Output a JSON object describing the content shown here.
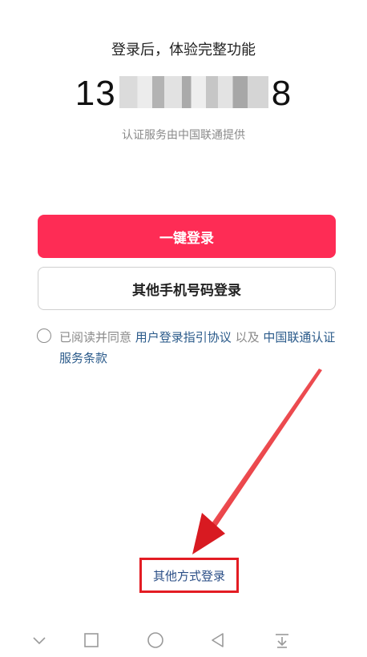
{
  "header": {
    "title": "登录后，体验完整功能",
    "phone_prefix": "13",
    "phone_suffix": "8",
    "provider_note": "认证服务由中国联通提供"
  },
  "actions": {
    "one_click_login": "一键登录",
    "other_phone_login": "其他手机号码登录"
  },
  "agreement": {
    "checked": false,
    "prefix": "已阅读并同意 ",
    "user_agreement": "用户登录指引协议",
    "connector": " 以及 ",
    "carrier_terms": "中国联通认证服务条款"
  },
  "other_methods_label": "其他方式登录",
  "colors": {
    "primary": "#fe2c55",
    "link": "#2a5a8a",
    "annotation_red": "#e31c23"
  },
  "navbar": {
    "icons": [
      "chevron-down-icon",
      "square-icon",
      "circle-home-icon",
      "triangle-back-icon",
      "pull-down-icon"
    ]
  }
}
